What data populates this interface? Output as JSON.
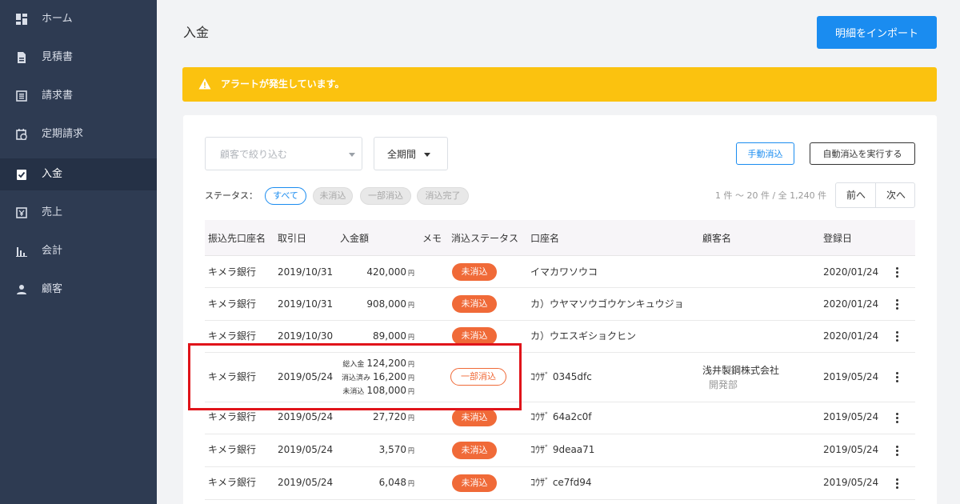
{
  "sidebar": {
    "items": [
      {
        "label": "ホーム",
        "icon": "dashboard-icon",
        "active": false
      },
      {
        "label": "見積書",
        "icon": "document-icon",
        "active": false
      },
      {
        "label": "請求書",
        "icon": "list-icon",
        "active": false
      },
      {
        "label": "定期請求",
        "icon": "calendar-clock-icon",
        "active": false
      },
      {
        "label": "入金",
        "icon": "check-clipboard-icon",
        "active": true
      },
      {
        "label": "売上",
        "icon": "yen-box-icon",
        "active": false
      },
      {
        "label": "会計",
        "icon": "bar-chart-icon",
        "active": false
      },
      {
        "label": "顧客",
        "icon": "person-icon",
        "active": false
      }
    ]
  },
  "header": {
    "title": "入金",
    "import_label": "明細をインポート"
  },
  "alert": {
    "text": "アラートが発生しています。",
    "color": "#fbc20f"
  },
  "filters": {
    "customer_placeholder": "顧客で絞り込む",
    "period_value": "全期間",
    "manual_label": "手動消込",
    "auto_label": "自動消込を実行する",
    "status_label": "ステータス：",
    "chips": [
      {
        "label": "すべて",
        "selected": true
      },
      {
        "label": "未消込",
        "selected": false
      },
      {
        "label": "一部消込",
        "selected": false
      },
      {
        "label": "消込完了",
        "selected": false
      }
    ]
  },
  "pagination": {
    "summary": "1 件 〜 20 件 / 全 1,240 件",
    "prev_label": "前へ",
    "next_label": "次へ"
  },
  "table": {
    "columns": [
      "振込先口座名",
      "取引日",
      "入金額",
      "メモ",
      "消込ステータス",
      "口座名",
      "顧客名",
      "登録日"
    ],
    "yen_unit": "円",
    "rows": [
      {
        "bank": "キメラ銀行",
        "date": "2019/10/31",
        "amount": "420,000",
        "status": "未消込",
        "account": "イマカワソウコ",
        "customer": "",
        "dept": "",
        "registered": "2020/01/24"
      },
      {
        "bank": "キメラ銀行",
        "date": "2019/10/31",
        "amount": "908,000",
        "status": "未消込",
        "account": "カ）ウヤマソウゴウケンキュウジョ",
        "customer": "",
        "dept": "",
        "registered": "2020/01/24"
      },
      {
        "bank": "キメラ銀行",
        "date": "2019/10/30",
        "amount": "89,000",
        "status": "未消込",
        "account": "カ）ウエスギショクヒン",
        "customer": "",
        "dept": "",
        "registered": "2020/01/24"
      },
      {
        "bank": "キメラ銀行",
        "date": "2019/05/24",
        "amounts": [
          {
            "label": "総入金",
            "value": "124,200"
          },
          {
            "label": "消込済み",
            "value": "16,200"
          },
          {
            "label": "未消込",
            "value": "108,000"
          }
        ],
        "status": "一部消込",
        "account": "ｺｳｻﾞ 0345dfc",
        "customer": "浅井製鋼株式会社",
        "dept": "開発部",
        "registered": "2019/05/24"
      },
      {
        "bank": "キメラ銀行",
        "date": "2019/05/24",
        "amount": "27,720",
        "status": "未消込",
        "account": "ｺｳｻﾞ 64a2c0f",
        "customer": "",
        "dept": "",
        "registered": "2019/05/24"
      },
      {
        "bank": "キメラ銀行",
        "date": "2019/05/24",
        "amount": "3,570",
        "status": "未消込",
        "account": "ｺｳｻﾞ 9deaa71",
        "customer": "",
        "dept": "",
        "registered": "2019/05/24"
      },
      {
        "bank": "キメラ銀行",
        "date": "2019/05/24",
        "amount": "6,048",
        "status": "未消込",
        "account": "ｺｳｻﾞ ce7fd94",
        "customer": "",
        "dept": "",
        "registered": "2019/05/24"
      }
    ]
  },
  "colors": {
    "sidebar": "#2e3b52",
    "primary": "#1a8cf0",
    "badge": "#f06a38",
    "highlight": "#e0141a"
  }
}
